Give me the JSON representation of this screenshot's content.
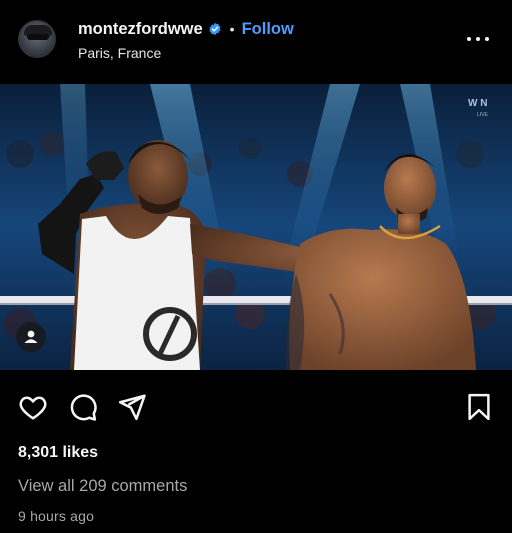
{
  "post": {
    "username": "montezfordwwe",
    "separator": "•",
    "follow_label": "Follow",
    "location": "Paris, France",
    "likes": "8,301 likes",
    "comments_link": "View all 209 comments",
    "timestamp": "9 hours ago",
    "photo_watermark": "W N",
    "photo_watermark_sub": "LIVE"
  },
  "colors": {
    "accent": "#4f9cff",
    "verified_badge": "#3897f0",
    "secondary_text": "#a8a8a8",
    "background": "#000000"
  },
  "icons": {
    "avatar": "profile-avatar",
    "verified": "verified-badge-icon",
    "more": "more-options-icon",
    "tag": "user-tag-icon",
    "like": "heart-icon",
    "comment": "comment-icon",
    "share": "send-icon",
    "save": "bookmark-icon"
  }
}
